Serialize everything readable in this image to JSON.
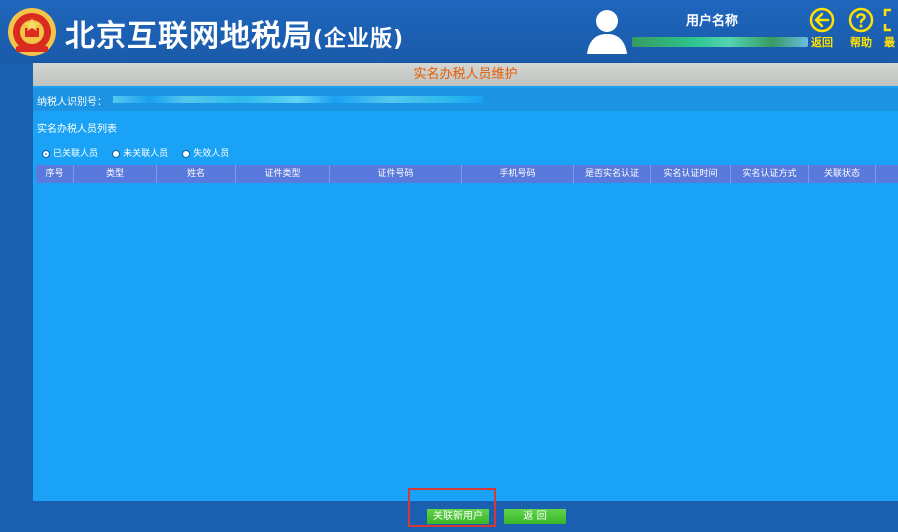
{
  "header": {
    "app_title": "北京互联网地税局",
    "app_edition": "(企业版)",
    "user_label": "用户名称",
    "nav": [
      {
        "label": "返回",
        "icon": "back-icon"
      },
      {
        "label": "帮助",
        "icon": "help-icon"
      },
      {
        "label": "最",
        "icon": "maximize-icon"
      }
    ]
  },
  "page": {
    "panel_title": "实名办税人员维护",
    "taxpayer_id_label": "纳税人识别号：",
    "list_caption": "实名办税人员列表",
    "filters": [
      {
        "label": "已关联人员",
        "checked": true
      },
      {
        "label": "未关联人员",
        "checked": false
      },
      {
        "label": "失效人员",
        "checked": false
      }
    ],
    "table": {
      "columns": [
        "序号",
        "类型",
        "姓名",
        "证件类型",
        "证件号码",
        "手机号码",
        "是否实名认证",
        "实名认证时间",
        "实名认证方式",
        "关联状态"
      ],
      "rows": []
    }
  },
  "actions": {
    "link_new_user": "关联新用户",
    "back": "返 回"
  },
  "colors": {
    "header_bg": "#1b5fb0",
    "panel_bg": "#1aa3f6",
    "table_header_bg": "#5a79dd",
    "accent_yellow": "#ffe200",
    "title_orange": "#e65a00",
    "button_green": "#3cb52a",
    "highlight_red": "#d43a3a"
  }
}
